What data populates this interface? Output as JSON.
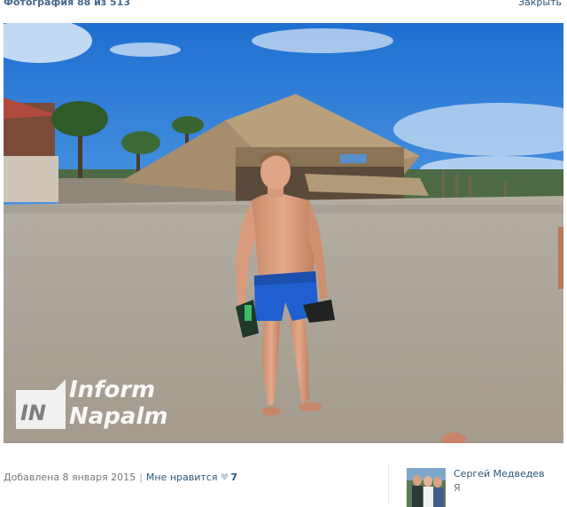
{
  "header": {
    "counter": "Фотография 88 из 513",
    "close_label": "Закрыть"
  },
  "photo": {
    "watermark_line1": "Inform",
    "watermark_line2": "Napalm",
    "watermark_badge": "IN"
  },
  "footer": {
    "added_label": "Добавлена 8 января 2015",
    "separator": "|",
    "like_label": "Мне нравится",
    "like_icon": "heart-icon",
    "like_count": "7",
    "owner_name": "Сергей Медведев",
    "owner_caption": "Я"
  },
  "colors": {
    "link": "#2b587a",
    "title": "#45688e",
    "muted": "#777777"
  }
}
